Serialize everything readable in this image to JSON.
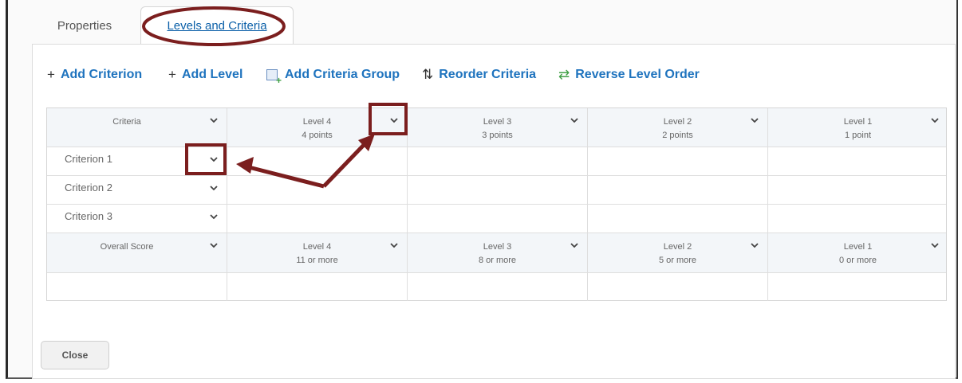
{
  "tabs": [
    {
      "label": "Properties",
      "active": false
    },
    {
      "label": "Levels and Criteria",
      "active": true
    }
  ],
  "toolbar": {
    "add_criterion": "Add Criterion",
    "add_level": "Add Level",
    "add_criteria_group": "Add Criteria Group",
    "reorder_criteria": "Reorder Criteria",
    "reverse_level_order": "Reverse Level Order"
  },
  "criteria_header": "Criteria",
  "levels": [
    {
      "name": "Level 4",
      "points": "4 points"
    },
    {
      "name": "Level 3",
      "points": "3 points"
    },
    {
      "name": "Level 2",
      "points": "2 points"
    },
    {
      "name": "Level 1",
      "points": "1 point"
    }
  ],
  "criteria": [
    "Criterion 1",
    "Criterion 2",
    "Criterion 3"
  ],
  "overall_header": "Overall Score",
  "overall_levels": [
    {
      "name": "Level 4",
      "range": "11 or more"
    },
    {
      "name": "Level 3",
      "range": "8 or more"
    },
    {
      "name": "Level 2",
      "range": "5 or more"
    },
    {
      "name": "Level 1",
      "range": "0 or more"
    }
  ],
  "close_label": "Close",
  "annotation_color": "#7b1e1e",
  "icons": [
    "plus-icon",
    "criteria-group-icon",
    "reorder-icon",
    "reverse-icon",
    "chevron-down-icon"
  ]
}
